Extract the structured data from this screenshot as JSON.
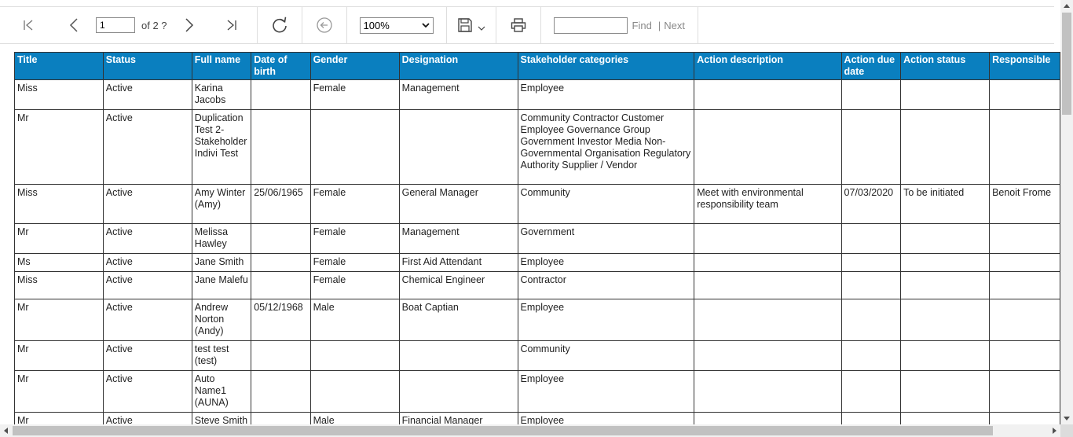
{
  "toolbar": {
    "page_value": "1",
    "page_of": "of 2 ?",
    "zoom_value": "100%",
    "find_label": "Find",
    "find_sep": "|",
    "next_label": "Next"
  },
  "table": {
    "columns": [
      "Title",
      "Status",
      "Full name",
      "Date of birth",
      "Gender",
      "Designation",
      "Stakeholder categories",
      "Action description",
      "Action due date",
      "Action status",
      "Responsible"
    ],
    "rows": [
      [
        "Miss",
        "Active",
        "Karina Jacobs",
        "",
        "Female",
        "Management",
        "Employee",
        "",
        "",
        "",
        ""
      ],
      [
        "Mr",
        "Active",
        "Duplication Test 2-Stakeholder Indivi Test",
        "",
        "",
        "",
        "Community  Contractor  Customer  Employee  Governance Group  Government  Investor  Media  Non-Governmental Organisation  Regulatory Authority  Supplier / Vendor",
        "",
        "",
        "",
        ""
      ],
      [
        "Miss",
        "Active",
        "Amy Winter (Amy)",
        "25/06/1965",
        "Female",
        "General Manager",
        "Community",
        "Meet with environmental responsibility team",
        "07/03/2020",
        "To be initiated",
        "Benoit Frome"
      ],
      [
        "Mr",
        "Active",
        "Melissa Hawley",
        "",
        "Female",
        "Management",
        "Government",
        "",
        "",
        "",
        ""
      ],
      [
        "Ms",
        "Active",
        "Jane Smith",
        "",
        "Female",
        "First Aid Attendant",
        "Employee",
        "",
        "",
        "",
        ""
      ],
      [
        "Miss",
        "Active",
        "Jane Malefu",
        "",
        "Female",
        "Chemical Engineer",
        "Contractor",
        "",
        "",
        "",
        ""
      ],
      [
        "Mr",
        "Active",
        "Andrew Norton (Andy)",
        "05/12/1968",
        "Male",
        "Boat Captian",
        "Employee",
        "",
        "",
        "",
        ""
      ],
      [
        "Mr",
        "Active",
        "test test (test)",
        "",
        "",
        "",
        "Community",
        "",
        "",
        "",
        ""
      ],
      [
        "Mr",
        "Active",
        "Auto Name1 (AUNA)",
        "",
        "",
        "",
        "Employee",
        "",
        "",
        "",
        ""
      ],
      [
        "Mr",
        "Active",
        "Steve Smith",
        "",
        "Male",
        "Financial Manager",
        "Employee",
        "",
        "",
        "",
        ""
      ]
    ]
  }
}
